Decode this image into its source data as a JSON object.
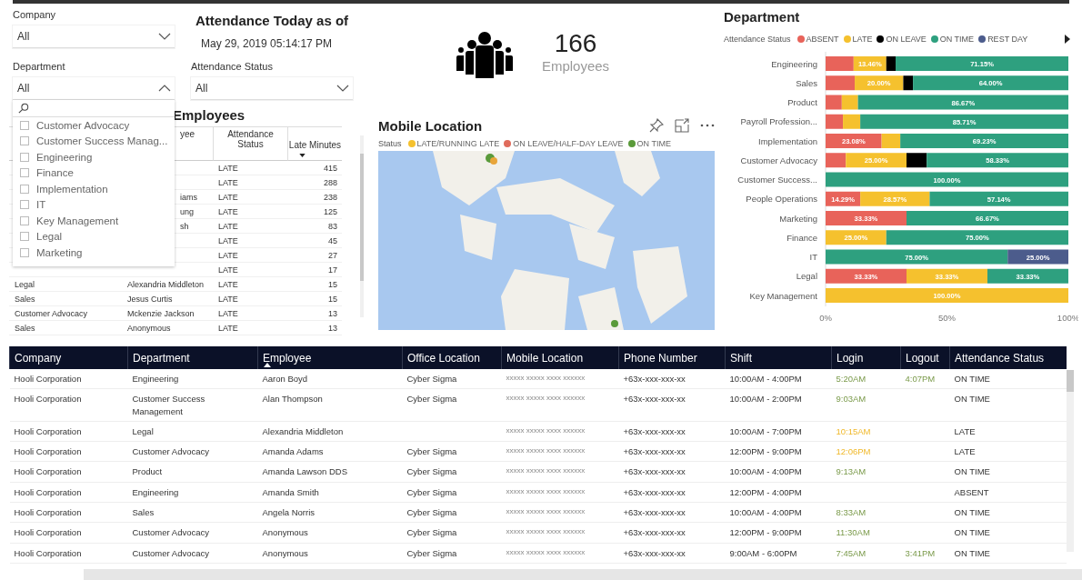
{
  "slicers": [
    {
      "label": "Company",
      "value": "All",
      "expanded": false
    },
    {
      "label": "Department",
      "value": "All",
      "expanded": true
    },
    {
      "label": "Attendance Status",
      "value": "All",
      "expanded": false
    }
  ],
  "heading": {
    "title": "Attendance Today as of",
    "timestamp": "May 29, 2019 05:14:17 PM"
  },
  "department_dropdown": {
    "items": [
      {
        "label": "Customer Advocacy",
        "checked": false
      },
      {
        "label": "Customer Success Manag...",
        "checked": false
      },
      {
        "label": "Engineering",
        "checked": false
      },
      {
        "label": "Finance",
        "checked": false
      },
      {
        "label": "Implementation",
        "checked": false
      },
      {
        "label": "IT",
        "checked": false
      },
      {
        "label": "Key Management",
        "checked": false
      },
      {
        "label": "Legal",
        "checked": false
      },
      {
        "label": "Marketing",
        "checked": false
      }
    ]
  },
  "late_table": {
    "title": "Employees",
    "columns": [
      "yee",
      "Attendance Status",
      "Late Minutes"
    ],
    "rows": [
      {
        "status": "LATE",
        "minutes": "415"
      },
      {
        "status": "LATE",
        "minutes": "288"
      },
      {
        "employee": "iams",
        "status": "LATE",
        "minutes": "238"
      },
      {
        "employee": "ung",
        "status": "LATE",
        "minutes": "125"
      },
      {
        "employee": "sh",
        "status": "LATE",
        "minutes": "83"
      },
      {
        "status": "LATE",
        "minutes": "45"
      },
      {
        "status": "LATE",
        "minutes": "27"
      },
      {
        "status": "LATE",
        "minutes": "17"
      },
      {
        "department": "Legal",
        "employee": "Alexandria Middleton",
        "status": "LATE",
        "minutes": "15"
      },
      {
        "department": "Sales",
        "employee": "Jesus Curtis",
        "status": "LATE",
        "minutes": "15"
      },
      {
        "department": "Customer Advocacy",
        "employee": "Mckenzie Jackson",
        "status": "LATE",
        "minutes": "13"
      },
      {
        "department": "Sales",
        "employee": "Anonymous",
        "status": "LATE",
        "minutes": "13"
      }
    ]
  },
  "kpi": {
    "value": "166",
    "label": "Employees"
  },
  "map": {
    "title": "Mobile Location",
    "legend_title": "Status",
    "legend": [
      {
        "label": "LATE/RUNNING LATE",
        "color": "#f5c12e"
      },
      {
        "label": "ON LEAVE/HALF-DAY LEAVE",
        "color": "#e06c5c"
      },
      {
        "label": "ON TIME",
        "color": "#5a9a3a"
      }
    ]
  },
  "department_chart": {
    "title": "Department",
    "legend_title": "Attendance Status",
    "chart_data": {
      "type": "bar",
      "orientation": "horizontal",
      "stacked": true,
      "categories": [
        "Engineering",
        "Sales",
        "Product",
        "Payroll Profession...",
        "Implementation",
        "Customer Advocacy",
        "Customer Success...",
        "People Operations",
        "Marketing",
        "Finance",
        "IT",
        "Legal",
        "Key Management"
      ],
      "series": [
        {
          "name": "ABSENT",
          "color": "#e8635a",
          "values": [
            11.54,
            12,
            6.67,
            7.14,
            23.08,
            8.33,
            0,
            14.29,
            33.33,
            0,
            0,
            33.33,
            0
          ],
          "value_labels": [
            null,
            null,
            null,
            null,
            "23.08%",
            null,
            null,
            "14.29%",
            "33.33%",
            null,
            null,
            "33.33%",
            null
          ]
        },
        {
          "name": "LATE",
          "color": "#f5c12e",
          "values": [
            13.46,
            20,
            6.67,
            7.14,
            7.69,
            25,
            0,
            28.57,
            0,
            25,
            0,
            33.33,
            100
          ],
          "value_labels": [
            "13.46%",
            "20.00%",
            null,
            null,
            null,
            "25.00%",
            null,
            "28.57%",
            null,
            "25.00%",
            null,
            "33.33%",
            "100.00%"
          ]
        },
        {
          "name": "ON LEAVE",
          "color": "#000000",
          "values": [
            3.85,
            4,
            0,
            0,
            0,
            8.33,
            0,
            0,
            0,
            0,
            0,
            0,
            0
          ],
          "value_labels": [
            null,
            null,
            null,
            null,
            null,
            null,
            null,
            null,
            null,
            null,
            null,
            null,
            null
          ]
        },
        {
          "name": "ON TIME",
          "color": "#2ea07f",
          "values": [
            71.15,
            64,
            86.67,
            85.71,
            69.23,
            58.33,
            100,
            57.14,
            66.67,
            75,
            75,
            33.33,
            0
          ],
          "value_labels": [
            "71.15%",
            "64.00%",
            "86.67%",
            "85.71%",
            "69.23%",
            "58.33%",
            "100.00%",
            "57.14%",
            "66.67%",
            "75.00%",
            "75.00%",
            "33.33%",
            null
          ]
        },
        {
          "name": "REST DAY",
          "color": "#4c5c8c",
          "values": [
            0,
            0,
            0,
            0,
            0,
            0,
            0,
            0,
            0,
            0,
            25,
            0,
            0
          ],
          "value_labels": [
            null,
            null,
            null,
            null,
            null,
            null,
            null,
            null,
            null,
            null,
            "25.00%",
            null,
            null
          ]
        }
      ],
      "xlim": [
        0,
        100
      ],
      "xticks": [
        {
          "value": 0,
          "label": "0%"
        },
        {
          "value": 50,
          "label": "50%"
        },
        {
          "value": 100,
          "label": "100%"
        }
      ]
    }
  },
  "main_table": {
    "columns": [
      "Company",
      "Department",
      "Employee",
      "Office Location",
      "Mobile Location",
      "Phone Number",
      "Shift",
      "Login",
      "Logout",
      "Attendance Status"
    ],
    "rows": [
      {
        "company": "Hooli Corporation",
        "department": "Engineering",
        "employee": "Aaron Boyd",
        "office": "Cyber Sigma",
        "mobile": "xxxxx xxxxx xxxx xxxxxx",
        "phone": "+63x-xxx-xxx-xx",
        "shift": "10:00AM - 4:00PM",
        "login": "5:20AM",
        "login_late": false,
        "logout": "4:07PM",
        "status": "ON TIME"
      },
      {
        "company": "Hooli Corporation",
        "department": "Customer Success Management",
        "employee": "Alan Thompson",
        "office": "Cyber Sigma",
        "mobile": "xxxxx xxxxx xxxx xxxxxx",
        "phone": "+63x-xxx-xxx-xx",
        "shift": "10:00AM - 2:00PM",
        "login": "9:03AM",
        "login_late": false,
        "status": "ON TIME"
      },
      {
        "company": "Hooli Corporation",
        "department": "Legal",
        "employee": "Alexandria Middleton",
        "mobile": "xxxxx xxxxx xxxx xxxxxx",
        "phone": "+63x-xxx-xxx-xx",
        "shift": "10:00AM - 7:00PM",
        "login": "10:15AM",
        "login_late": true,
        "status": "LATE"
      },
      {
        "company": "Hooli Corporation",
        "department": "Customer Advocacy",
        "employee": "Amanda Adams",
        "office": "Cyber Sigma",
        "mobile": "xxxxx xxxxx xxxx xxxxxx",
        "phone": "+63x-xxx-xxx-xx",
        "shift": "12:00PM - 9:00PM",
        "login": "12:06PM",
        "login_late": true,
        "status": "LATE"
      },
      {
        "company": "Hooli Corporation",
        "department": "Product",
        "employee": "Amanda Lawson DDS",
        "office": "Cyber Sigma",
        "mobile": "xxxxx xxxxx xxxx xxxxxx",
        "phone": "+63x-xxx-xxx-xx",
        "shift": "10:00AM - 4:00PM",
        "login": "9:13AM",
        "login_late": false,
        "status": "ON TIME"
      },
      {
        "company": "Hooli Corporation",
        "department": "Engineering",
        "employee": "Amanda Smith",
        "office": "Cyber Sigma",
        "mobile": "xxxxx xxxxx xxxx xxxxxx",
        "phone": "+63x-xxx-xxx-xx",
        "shift": "12:00PM - 4:00PM",
        "status": "ABSENT"
      },
      {
        "company": "Hooli Corporation",
        "department": "Sales",
        "employee": "Angela Norris",
        "office": "Cyber Sigma",
        "mobile": "xxxxx xxxxx xxxx xxxxxx",
        "phone": "+63x-xxx-xxx-xx",
        "shift": "10:00AM - 4:00PM",
        "login": "8:33AM",
        "login_late": false,
        "status": "ON TIME"
      },
      {
        "company": "Hooli Corporation",
        "department": "Customer Advocacy",
        "employee": "Anonymous",
        "office": "Cyber Sigma",
        "mobile": "xxxxx xxxxx xxxx xxxxxx",
        "phone": "+63x-xxx-xxx-xx",
        "shift": "12:00PM - 9:00PM",
        "login": "11:30AM",
        "login_late": false,
        "status": "ON TIME"
      },
      {
        "company": "Hooli Corporation",
        "department": "Customer Advocacy",
        "employee": "Anonymous",
        "office": "Cyber Sigma",
        "mobile": "xxxxx xxxxx xxxx xxxxxx",
        "phone": "+63x-xxx-xxx-xx",
        "shift": "9:00AM - 6:00PM",
        "login": "7:45AM",
        "login_late": false,
        "logout": "3:41PM",
        "status": "ON TIME"
      }
    ]
  }
}
